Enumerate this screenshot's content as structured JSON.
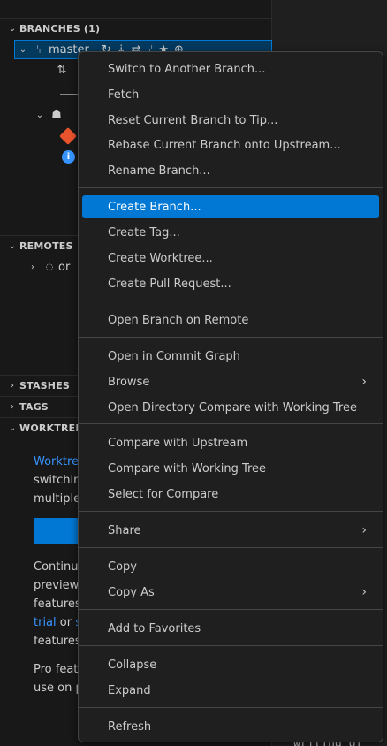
{
  "sidebar": {
    "branches_title": "BRANCHES (1)",
    "branch_name": "master",
    "remotes_title": "REMOTES",
    "remote_name": "or",
    "stashes_title": "STASHES",
    "tags_title": "TAGS",
    "worktrees_title": "WORKTREES",
    "wt_line1_link": "Worktre",
    "wt_line2": "switchin",
    "wt_line3": "multiple",
    "wt_line4": "Continu",
    "wt_line5": "preview",
    "wt_line6": "features",
    "wt_line7_link": "trial",
    "wt_line7_mid": " or ",
    "wt_line7_link2": "s",
    "wt_line8": "features",
    "wt_line9": "Pro feat",
    "wt_line10": "use on p"
  },
  "editor": {
    "bottom_text": "writing of"
  },
  "menu": {
    "items": [
      {
        "label": "Switch to Another Branch..."
      },
      {
        "label": "Fetch"
      },
      {
        "label": "Reset Current Branch to Tip..."
      },
      {
        "label": "Rebase Current Branch onto Upstream..."
      },
      {
        "label": "Rename Branch..."
      },
      {
        "label": "Create Branch..."
      },
      {
        "label": "Create Tag..."
      },
      {
        "label": "Create Worktree..."
      },
      {
        "label": "Create Pull Request..."
      },
      {
        "label": "Open Branch on Remote"
      },
      {
        "label": "Open in Commit Graph"
      },
      {
        "label": "Browse"
      },
      {
        "label": "Open Directory Compare with Working Tree"
      },
      {
        "label": "Compare with Upstream"
      },
      {
        "label": "Compare with Working Tree"
      },
      {
        "label": "Select for Compare"
      },
      {
        "label": "Share"
      },
      {
        "label": "Copy"
      },
      {
        "label": "Copy As"
      },
      {
        "label": "Add to Favorites"
      },
      {
        "label": "Collapse"
      },
      {
        "label": "Expand"
      },
      {
        "label": "Refresh"
      }
    ]
  }
}
